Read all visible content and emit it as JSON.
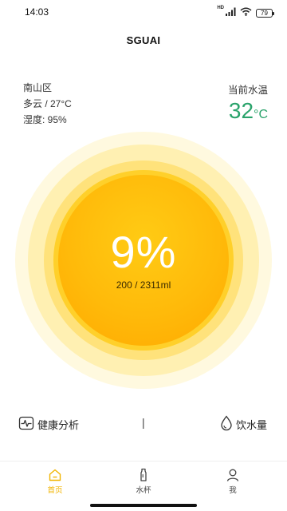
{
  "status_bar": {
    "time": "14:03",
    "network_label": "HD",
    "battery": "79",
    "icons": [
      "signal-icon",
      "wifi-icon",
      "battery-icon"
    ]
  },
  "header": {
    "title": "SGUAI"
  },
  "weather": {
    "district": "南山区",
    "condition": "多云 / 27°C",
    "humidity": "湿度: 95%"
  },
  "water_temp": {
    "label": "当前水温",
    "value": "32",
    "unit": "°C",
    "color": "#2aa36b"
  },
  "progress": {
    "percent_text": "9%",
    "volume_text": "200 / 2311ml",
    "fraction": 0.09,
    "color": "#ffb800"
  },
  "actions": {
    "health_label": "健康分析",
    "separator": "|",
    "water_label": "饮水量",
    "icons": [
      "heartbeat-icon",
      "water-drop-icon"
    ]
  },
  "tabs": [
    {
      "label": "首页",
      "icon": "home-icon",
      "active": true
    },
    {
      "label": "水杯",
      "icon": "bottle-icon",
      "active": false
    },
    {
      "label": "我",
      "icon": "person-icon",
      "active": false
    }
  ],
  "accent_color": "#f1b400"
}
